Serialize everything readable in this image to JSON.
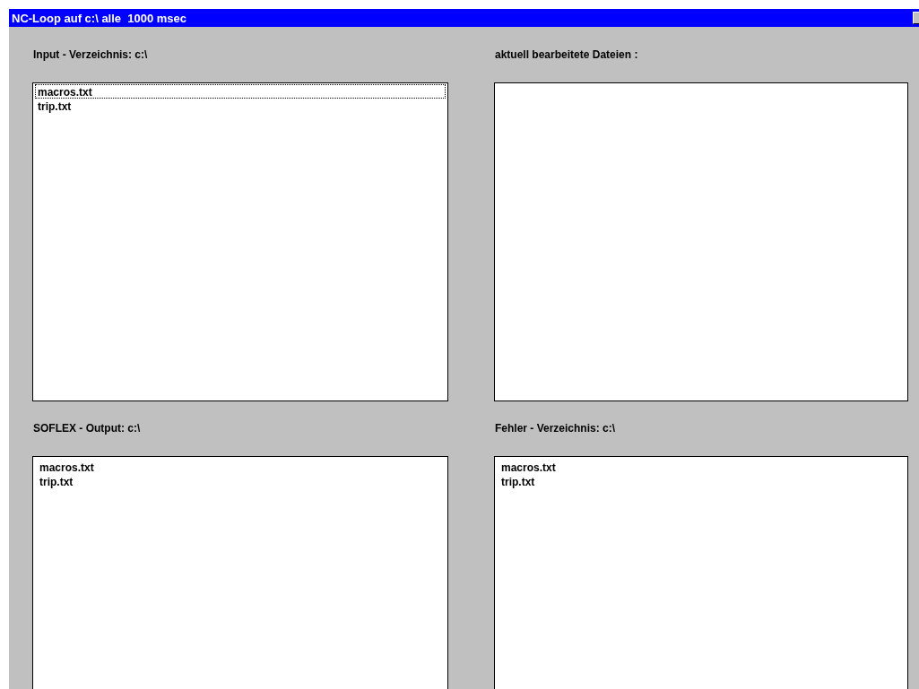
{
  "window": {
    "title": "NC-Loop auf c:\\ alle  1000 msec"
  },
  "panels": [
    {
      "label": "Input - Verzeichnis: c:\\",
      "items": [
        {
          "name": "macros.txt",
          "focused": true
        },
        {
          "name": "trip.txt",
          "focused": false
        }
      ]
    },
    {
      "label": "aktuell bearbeitete Dateien :"
    },
    {
      "label": "SOFLEX - Output: c:\\",
      "items": [
        {
          "name": "macros.txt",
          "focused": false
        },
        {
          "name": "trip.txt",
          "focused": false
        }
      ]
    },
    {
      "label": "Fehler - Verzeichnis: c:\\",
      "items": [
        {
          "name": "macros.txt",
          "focused": false
        },
        {
          "name": "trip.txt",
          "focused": false
        }
      ]
    }
  ]
}
